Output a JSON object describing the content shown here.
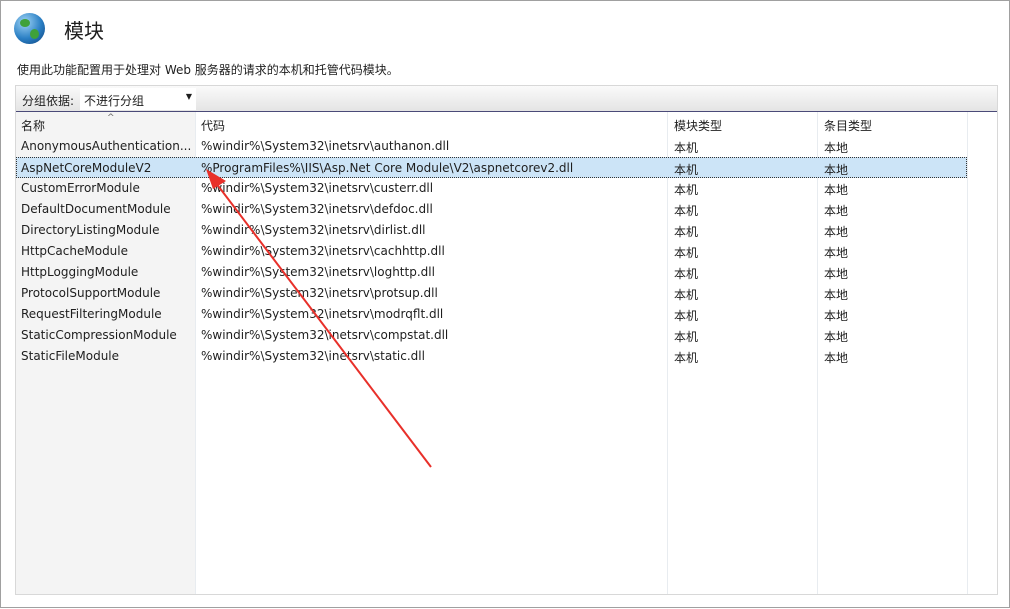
{
  "header": {
    "title": "模块",
    "icon": "globe-icon",
    "description": "使用此功能配置用于处理对 Web 服务器的请求的本机和托管代码模块。"
  },
  "toolbar": {
    "group_label": "分组依据:",
    "group_value": "不进行分组"
  },
  "table": {
    "columns": [
      "名称",
      "代码",
      "模块类型",
      "条目类型"
    ],
    "selected_index": 1,
    "rows": [
      [
        "AnonymousAuthentication...",
        "%windir%\\System32\\inetsrv\\authanon.dll",
        "本机",
        "本地"
      ],
      [
        "AspNetCoreModuleV2",
        "%ProgramFiles%\\IIS\\Asp.Net Core Module\\V2\\aspnetcorev2.dll",
        "本机",
        "本地"
      ],
      [
        "CustomErrorModule",
        "%windir%\\System32\\inetsrv\\custerr.dll",
        "本机",
        "本地"
      ],
      [
        "DefaultDocumentModule",
        "%windir%\\System32\\inetsrv\\defdoc.dll",
        "本机",
        "本地"
      ],
      [
        "DirectoryListingModule",
        "%windir%\\System32\\inetsrv\\dirlist.dll",
        "本机",
        "本地"
      ],
      [
        "HttpCacheModule",
        "%windir%\\System32\\inetsrv\\cachhttp.dll",
        "本机",
        "本地"
      ],
      [
        "HttpLoggingModule",
        "%windir%\\System32\\inetsrv\\loghttp.dll",
        "本机",
        "本地"
      ],
      [
        "ProtocolSupportModule",
        "%windir%\\System32\\inetsrv\\protsup.dll",
        "本机",
        "本地"
      ],
      [
        "RequestFilteringModule",
        "%windir%\\System32\\inetsrv\\modrqflt.dll",
        "本机",
        "本地"
      ],
      [
        "StaticCompressionModule",
        "%windir%\\System32\\inetsrv\\compstat.dll",
        "本机",
        "本地"
      ],
      [
        "StaticFileModule",
        "%windir%\\System32\\inetsrv\\static.dll",
        "本机",
        "本地"
      ]
    ]
  },
  "annotation": {
    "arrow_color": "#e8302a"
  }
}
